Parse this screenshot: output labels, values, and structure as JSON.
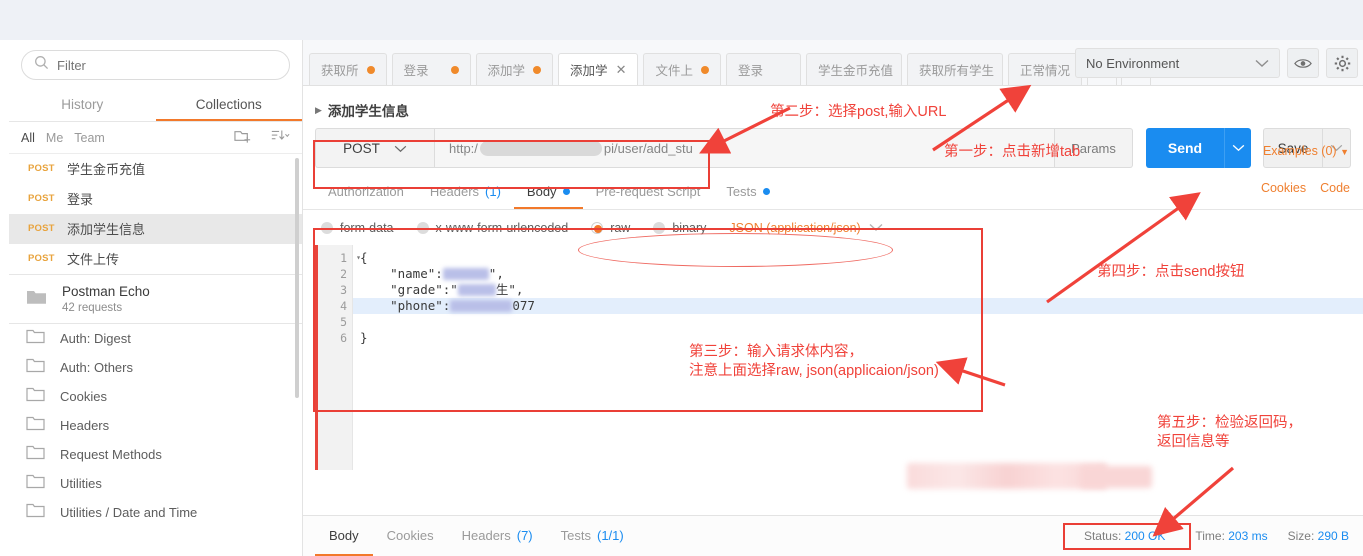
{
  "sidebar": {
    "filter_placeholder": "Filter",
    "tabs": [
      {
        "label": "History",
        "active": false
      },
      {
        "label": "Collections",
        "active": true
      }
    ],
    "scope_filters": [
      {
        "label": "All",
        "active": true
      },
      {
        "label": "Me",
        "active": false
      },
      {
        "label": "Team",
        "active": false
      }
    ],
    "new_folder_icon": "new-folder-icon",
    "sort_icon": "sort-icon",
    "requests": [
      {
        "method": "POST",
        "name": "学生金币充值",
        "selected": false
      },
      {
        "method": "POST",
        "name": "登录",
        "selected": false
      },
      {
        "method": "POST",
        "name": "添加学生信息",
        "selected": true
      },
      {
        "method": "POST",
        "name": "文件上传",
        "selected": false
      }
    ],
    "collection": {
      "name": "Postman Echo",
      "subtitle": "42 requests",
      "icon": "collection-folder-icon"
    },
    "folders": [
      {
        "label": "Auth: Digest"
      },
      {
        "label": "Auth: Others"
      },
      {
        "label": "Cookies"
      },
      {
        "label": "Headers"
      },
      {
        "label": "Request Methods"
      },
      {
        "label": "Utilities"
      },
      {
        "label": "Utilities / Date and Time"
      }
    ]
  },
  "tabbar": {
    "tabs": [
      {
        "label": "获取所",
        "dirty": true,
        "active": false
      },
      {
        "label": "登录",
        "dirty": true,
        "active": false
      },
      {
        "label": "添加学",
        "dirty": true,
        "active": false
      },
      {
        "label": "添加学",
        "dirty": false,
        "active": true,
        "close": "✕"
      },
      {
        "label": "文件上",
        "dirty": true,
        "active": false
      },
      {
        "label": "登录",
        "dirty": false,
        "active": false
      },
      {
        "label": "学生金币充值",
        "dirty": false,
        "active": false
      },
      {
        "label": "获取所有学生",
        "dirty": false,
        "active": false
      },
      {
        "label": "正常情况",
        "dirty": false,
        "active": false
      }
    ],
    "add_tab_label": "+",
    "more_label": "•••"
  },
  "header": {
    "environment": "No Environment",
    "eye_icon": "eye-icon",
    "gear_icon": "gear-icon"
  },
  "request": {
    "title": "添加学生信息",
    "examples_label": "Examples (0)",
    "method": "POST",
    "url_prefix": "http:/",
    "url_suffix": "pi/user/add_stu",
    "params_label": "Params",
    "send_label": "Send",
    "save_label": "Save",
    "subtabs": [
      {
        "label": "Authorization",
        "active": false,
        "badge": "",
        "dot": false
      },
      {
        "label": "Headers",
        "active": false,
        "badge": "(1)",
        "dot": false
      },
      {
        "label": "Body",
        "active": true,
        "badge": "",
        "dot": true
      },
      {
        "label": "Pre-request Script",
        "active": false,
        "badge": "",
        "dot": false
      },
      {
        "label": "Tests",
        "active": false,
        "badge": "",
        "dot": true
      }
    ],
    "cookies_label": "Cookies",
    "code_label": "Code"
  },
  "body": {
    "types": [
      {
        "label": "form-data",
        "selected": false
      },
      {
        "label": "x-www-form-urlencoded",
        "selected": false
      },
      {
        "label": "raw",
        "selected": true
      },
      {
        "label": "binary",
        "selected": false
      }
    ],
    "format": "JSON (application/json)",
    "lines": [
      "1",
      "2",
      "3",
      "4",
      "5",
      "6"
    ],
    "code": {
      "l1": "{",
      "l2_key": "    \"name\":",
      "l2_tail": "\",",
      "l3_key": "    \"grade\":\"",
      "l3_tail": "生\",",
      "l4_key": "    \"phone\":",
      "l4_tail": "077",
      "l5": "",
      "l6": "}"
    }
  },
  "response": {
    "tabs": [
      {
        "label": "Body",
        "badge": "",
        "active": true
      },
      {
        "label": "Cookies",
        "badge": "",
        "active": false
      },
      {
        "label": "Headers",
        "badge": "(7)",
        "active": false
      },
      {
        "label": "Tests",
        "badge": "(1/1)",
        "active": false
      }
    ],
    "status_label": "Status:",
    "status_value": "200 OK",
    "time_label": "Time:",
    "time_value": "203 ms",
    "size_label": "Size:",
    "size_value": "290 B"
  },
  "annotations": {
    "step1": "第一步：点击新增tab",
    "step2": "第二步：选择post,输入URL",
    "step3_line1": "第三步：输入请求体内容，",
    "step3_line2": "注意上面选择raw, json(applicaion/json)",
    "step4": "第四步：点击send按钮",
    "step5_line1": "第五步：检验返回码，",
    "step5_line2": "返回信息等"
  },
  "colors": {
    "accent_orange": "#f2792b",
    "send_blue": "#1a8cf0",
    "annotation_red": "#f0423a",
    "method_orange": "#e8a33d"
  }
}
